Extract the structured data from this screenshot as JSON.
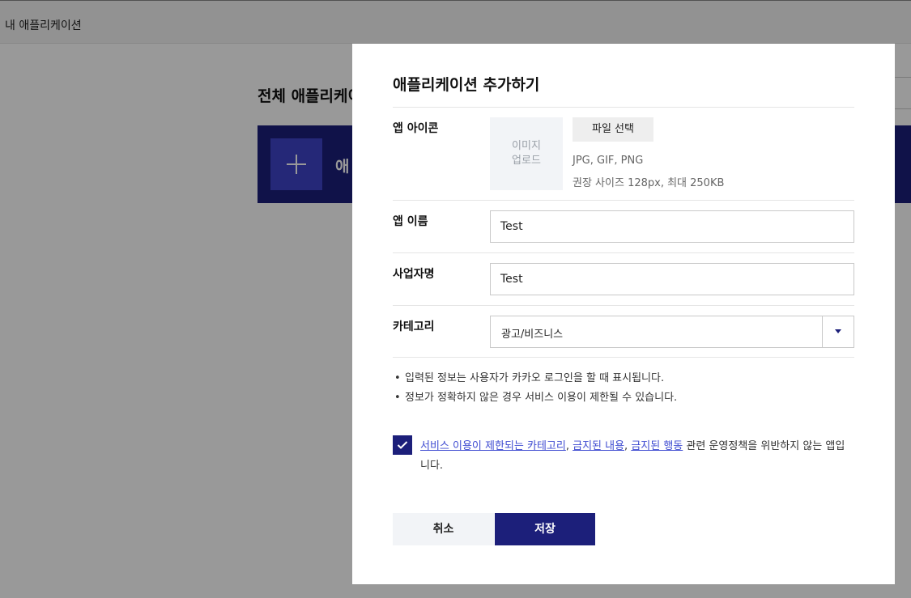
{
  "topbar": {
    "title": "내 애플리케이션"
  },
  "background": {
    "heading": "전체 애플리케이",
    "card_label": "애"
  },
  "modal": {
    "title": "애플리케이션 추가하기",
    "icon": {
      "label": "앱 아이콘",
      "placeholder_line1": "이미지",
      "placeholder_line2": "업로드",
      "file_button": "파일 선택",
      "hint_formats": "JPG, GIF, PNG",
      "hint_size": "권장 사이즈 128px, 최대 250KB"
    },
    "app_name": {
      "label": "앱 이름",
      "value": "Test"
    },
    "company_name": {
      "label": "사업자명",
      "value": "Test"
    },
    "category": {
      "label": "카테고리",
      "value": "광고/비즈니스"
    },
    "notes": [
      "입력된 정보는 사용자가 카카오 로그인을 할 때 표시됩니다.",
      "정보가 정확하지 않은 경우 서비스 이용이 제한될 수 있습니다."
    ],
    "agreement": {
      "checked": true,
      "link1": "서비스 이용이 제한되는 카테고리",
      "sep1": ", ",
      "link2": "금지된 내용",
      "sep2": ", ",
      "link3": "금지된 행동",
      "rest": " 관련 운영정책을 위반하지 않는 앱입니다."
    },
    "buttons": {
      "cancel": "취소",
      "save": "저장"
    }
  },
  "colors": {
    "primary": "#1c1f7a",
    "link": "#3e4bd1",
    "overlay": "rgba(0,0,0,0.4)"
  }
}
